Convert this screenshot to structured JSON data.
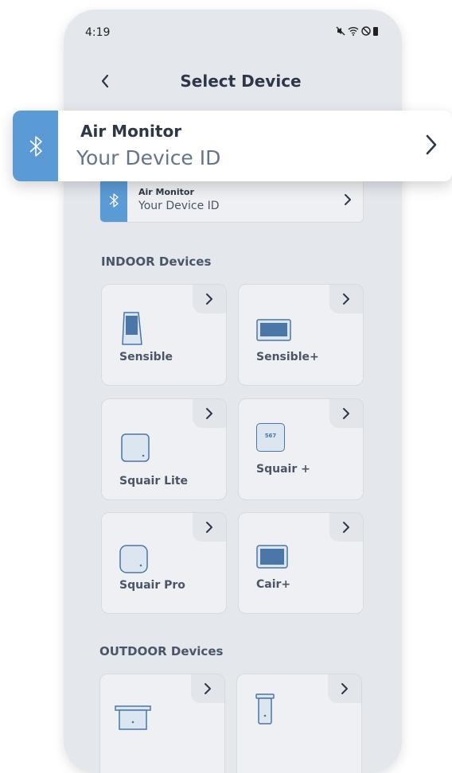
{
  "status_bar": {
    "time": "4:19"
  },
  "header": {
    "title": "Select Device"
  },
  "selected_device": {
    "title": "Air Monitor",
    "subtitle": "Your Device ID"
  },
  "sections": {
    "indoor": "INDOOR Devices",
    "outdoor": "OUTDOOR Devices"
  },
  "indoor_devices": [
    {
      "name": "Sensible"
    },
    {
      "name": "Sensible+"
    },
    {
      "name": "Squair Lite"
    },
    {
      "name": "Squair +"
    },
    {
      "name": "Squair Pro"
    },
    {
      "name": "Cair+"
    }
  ],
  "device_badge": {
    "squair_plus_reading": "567"
  },
  "icons": [
    "back-chevron-icon",
    "bluetooth-icon",
    "chevron-right-icon",
    "mute-icon",
    "wifi-icon",
    "dnd-icon",
    "battery-icon"
  ],
  "colors": {
    "accent": "#5b9bd5",
    "background": "#e4e8ed",
    "card": "#eef0f3"
  }
}
